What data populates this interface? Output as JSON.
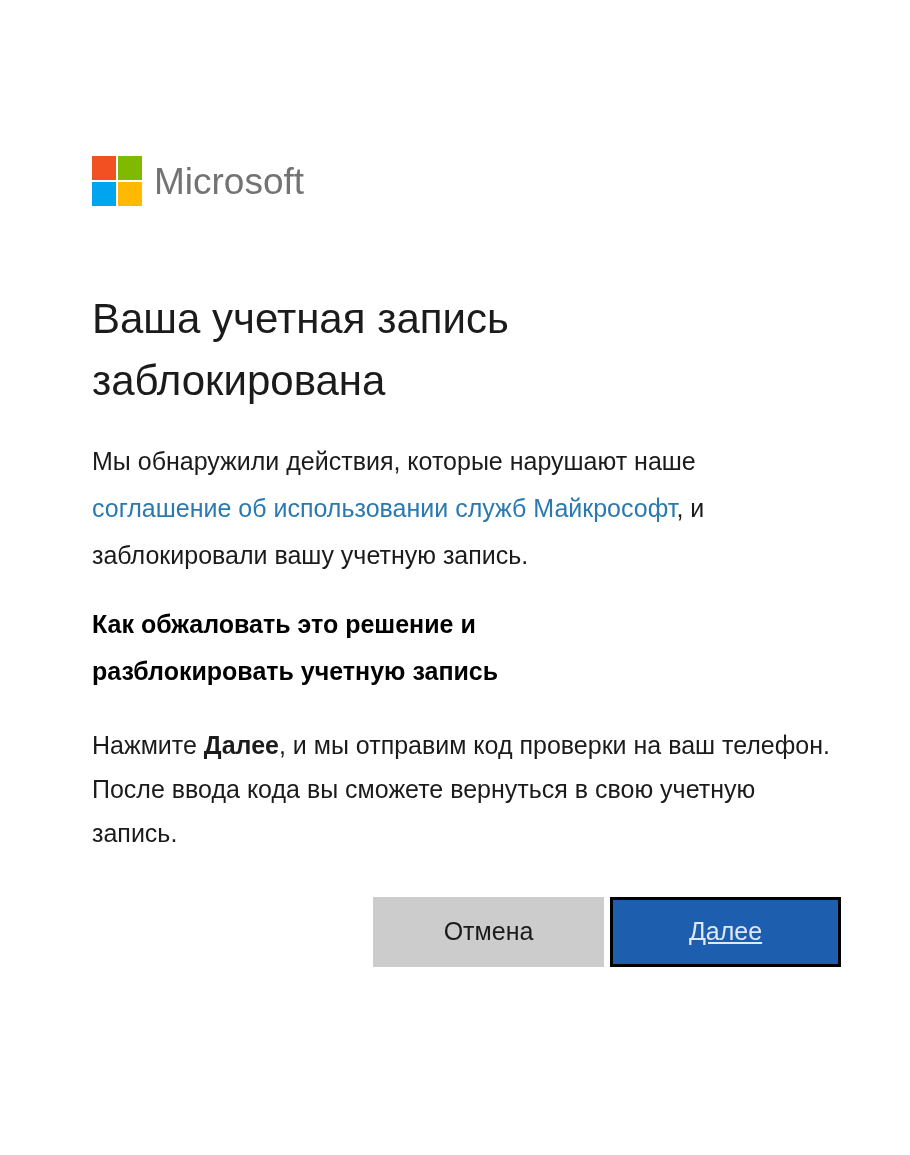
{
  "logo": {
    "text": "Microsoft"
  },
  "title": "Ваша учетная запись заблокирована",
  "message": [
    {
      "kind": "text",
      "text": "Мы обнаружили действия, которые нарушают наше"
    },
    {
      "kind": "link",
      "text": "соглашение об использовании служб Майкрософт"
    },
    {
      "kind": "text",
      "text": ", и заблокировали вашу учетную запись."
    }
  ],
  "subheading": "Как обжаловать это решение и разблокировать учетную запись",
  "instructions": "Нажмите **Далее**, и мы отправим код проверки на ваш телефон. После ввода кода вы сможете вернуться в свою учетную запись.",
  "buttons": [
    {
      "label": "Отмена",
      "kind": "secondary",
      "focused": false
    },
    {
      "label": "Далее",
      "kind": "primary",
      "focused": true
    }
  ]
}
